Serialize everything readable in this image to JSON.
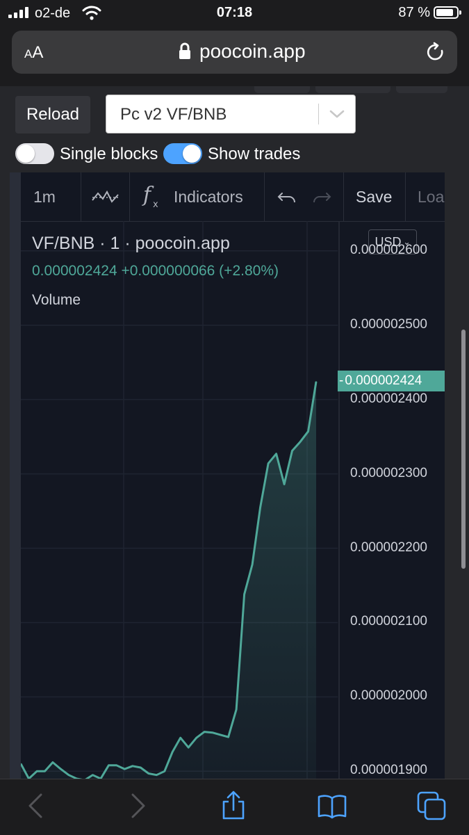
{
  "status_bar": {
    "carrier": "o2-de",
    "time": "07:18",
    "battery_percent": "87 %",
    "battery_level": 0.87
  },
  "browser": {
    "text_size_label_small": "A",
    "text_size_label_large": "A",
    "url": "poocoin.app"
  },
  "controls": {
    "reload_label": "Reload",
    "pair_select_value": "Pc v2 VF/BNB",
    "single_blocks_label": "Single blocks",
    "single_blocks_on": false,
    "show_trades_label": "Show trades",
    "show_trades_on": true
  },
  "toolbar": {
    "interval": "1m",
    "indicators_label": "Indicators",
    "save_label": "Save",
    "load_label": "Load"
  },
  "legend": {
    "title": "VF/BNB · 1 · poocoin.app",
    "price_line": "0.000002424 +0.000000066 (+2.80%)",
    "volume_label": "Volume",
    "currency_button": "USD"
  },
  "colors": {
    "accent": "#4fa899",
    "chart_bg": "#131722",
    "toggle_on": "#4da3ff",
    "toggle_off": "#e5e5ea"
  },
  "chart_data": {
    "type": "area",
    "title": "VF/BNB · 1 · poocoin.app",
    "ylabel": "",
    "xlabel": "",
    "ylim": [
      1.89e-06,
      2.64e-06
    ],
    "y_ticks": [
      "0.000002600",
      "0.000002500",
      "0.000002400",
      "0.000002300",
      "0.000002200",
      "0.000002100",
      "0.000002000",
      "0.000001900"
    ],
    "last_price_label": "0.000002424",
    "series": [
      {
        "values": [
          1.91e-06,
          1.89e-06,
          1.9e-06,
          1.9e-06,
          1.912e-06,
          1.903e-06,
          1.895e-06,
          1.89e-06,
          1.888e-06,
          1.895e-06,
          1.89e-06,
          1.908e-06,
          1.908e-06,
          1.903e-06,
          1.907e-06,
          1.905e-06,
          1.897e-06,
          1.895e-06,
          1.9e-06,
          1.926e-06,
          1.945e-06,
          1.932e-06,
          1.945e-06,
          1.953e-06,
          1.952e-06,
          1.949e-06,
          1.946e-06,
          1.983e-06,
          2.138e-06,
          2.178e-06,
          2.255e-06,
          2.314e-06,
          2.327e-06,
          2.286e-06,
          2.331e-06,
          2.343e-06,
          2.357e-06,
          2.424e-06
        ]
      }
    ]
  }
}
